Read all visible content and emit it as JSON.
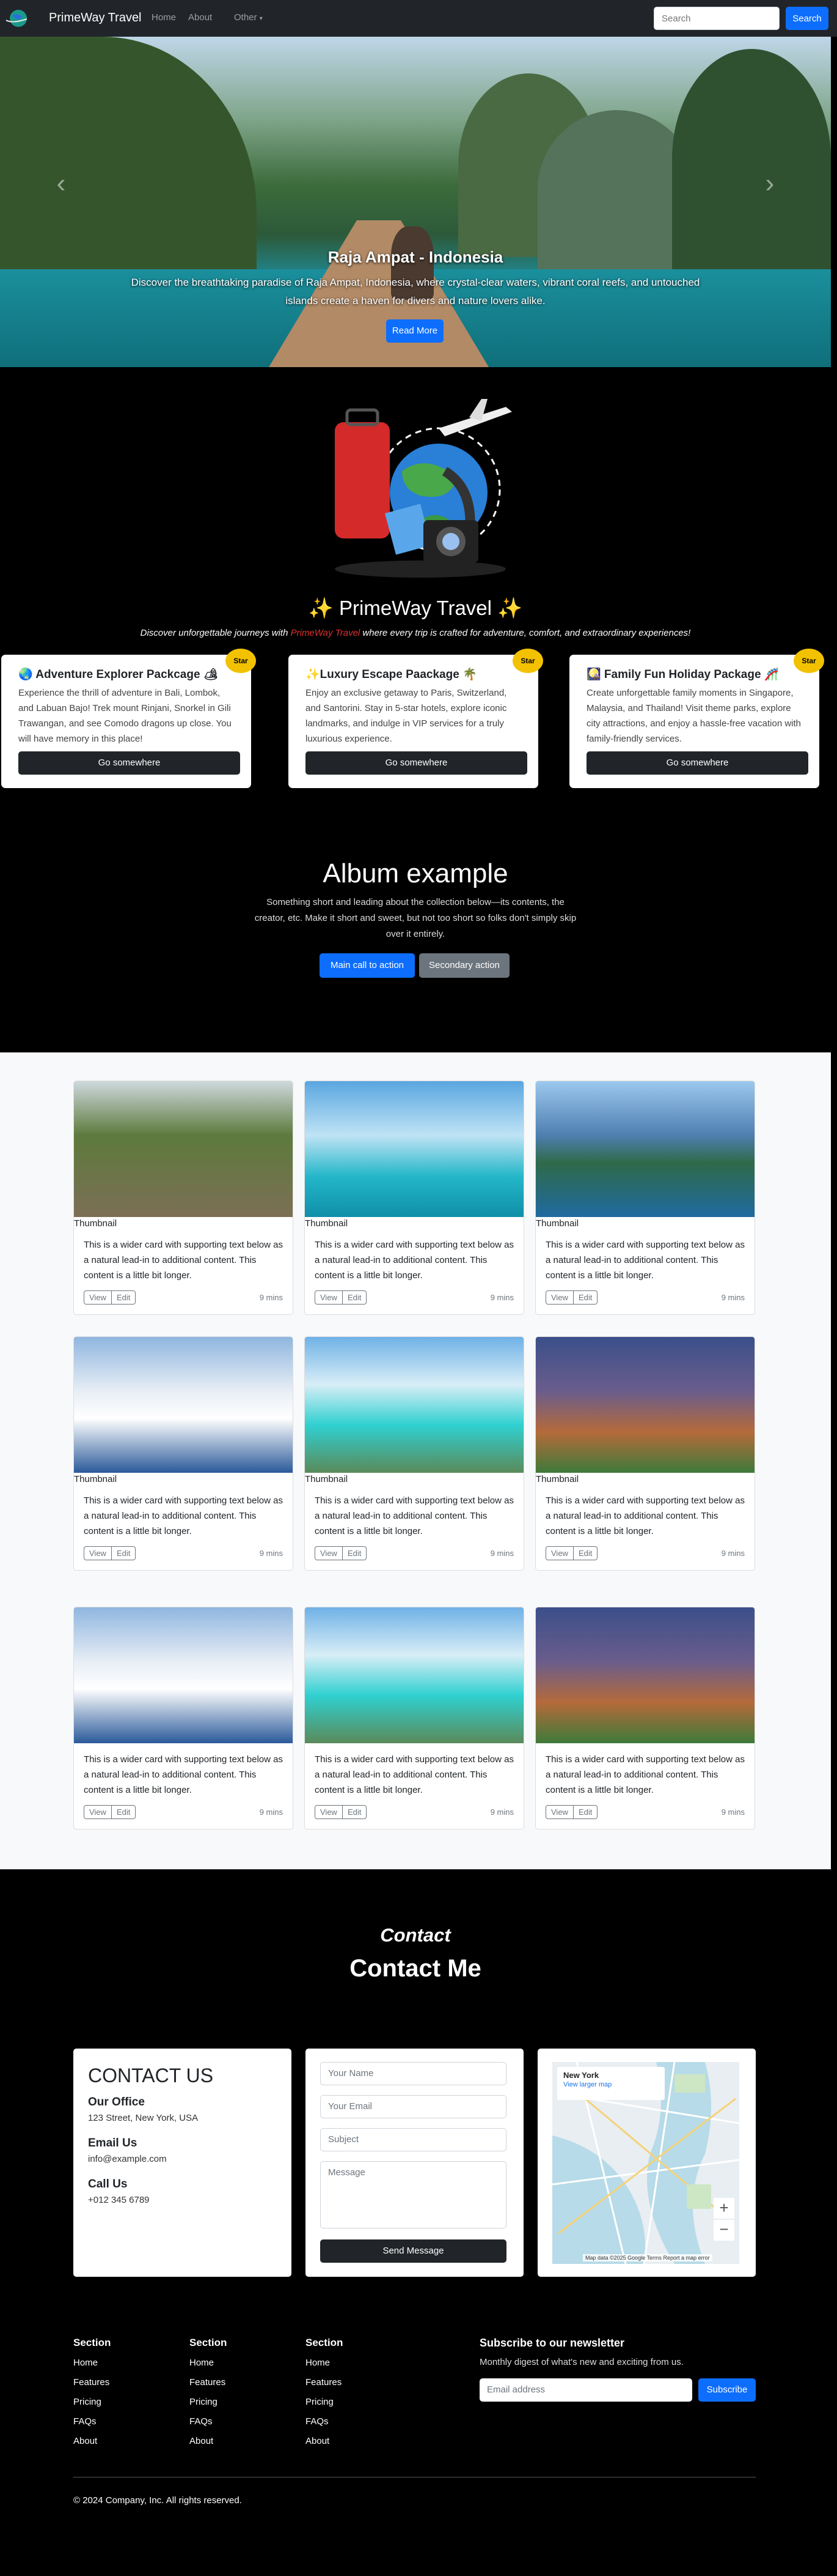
{
  "nav": {
    "brand": "PrimeWay Travel",
    "links": [
      "Home",
      "About",
      "Other"
    ],
    "search_placeholder": "Search",
    "search_button": "Search"
  },
  "hero": {
    "title": "Raja Ampat - Indonesia",
    "text": "Discover the breathtaking paradise of Raja Ampat, Indonesia, where crystal-clear waters, vibrant coral reefs, and untouched islands create a haven for divers and nature lovers alike.",
    "button": "Read More"
  },
  "intro": {
    "title": "✨ PrimeWay Travel ✨",
    "tag_pre": "Discover unforgettable journeys with ",
    "tag_brand": "PrimeWay Travel",
    "tag_post": " where every trip is crafted for adventure, comfort, and extraordinary experiences!"
  },
  "packages": [
    {
      "title": "🌏 Adventure Explorer Packcage 🏕",
      "text": "Experience the thrill of adventure in Bali, Lombok, and Labuan Bajo! Trek mount Rinjani, Snorkel in Gili Trawangan, and see Comodo dragons up close. You will have memory in this place!",
      "button": "Go somewhere",
      "badge": "Star"
    },
    {
      "title": "✨Luxury Escape Paackage 🌴",
      "text": "Enjoy an exclusive getaway to Paris, Switzerland, and Santorini. Stay in 5-star hotels, explore iconic landmarks, and indulge in VIP services for a truly luxurious experience.",
      "button": "Go somewhere",
      "badge": "Star"
    },
    {
      "title": "🎑 Family Fun Holiday Package 🎢",
      "text": "Create unforgettable family moments in Singapore, Malaysia, and Thailand! Visit theme parks, explore city attractions, and enjoy a hassle-free vacation with family-friendly services.",
      "button": "Go somewhere",
      "badge": "Star"
    }
  ],
  "album": {
    "title": "Album example",
    "text": "Something short and leading about the collection below—its contents, the creator, etc. Make it short and sweet, but not too short so folks don't simply skip over it entirely.",
    "primary": "Main call to action",
    "secondary": "Secondary action"
  },
  "cards": {
    "thumb": "Thumbnail",
    "text": "This is a wider card with supporting text below as a natural lead-in to additional content. This content is a little bit longer.",
    "view": "View",
    "edit": "Edit",
    "mins": "9 mins"
  },
  "contact": {
    "small": "Contact",
    "big": "Contact Me",
    "heading": "CONTACT US",
    "office_label": "Our Office",
    "office": "123 Street, New York, USA",
    "email_label": "Email Us",
    "email": "info@example.com",
    "call_label": "Call Us",
    "phone": "+012 345 6789",
    "name_ph": "Your Name",
    "email_ph": "Your Email",
    "subject_ph": "Subject",
    "message_ph": "Message",
    "send": "Send Message",
    "map_city": "New York",
    "map_link": "View larger map",
    "map_credit": "Map data ©2025 Google  Terms  Report a map error"
  },
  "footer": {
    "section": "Section",
    "links": [
      "Home",
      "Features",
      "Pricing",
      "FAQs",
      "About"
    ],
    "nl_title": "Subscribe to our newsletter",
    "nl_text": "Monthly digest of what's new and exciting from us.",
    "nl_ph": "Email address",
    "nl_btn": "Subscribe",
    "copy": "© 2024 Company, Inc. All rights reserved."
  }
}
